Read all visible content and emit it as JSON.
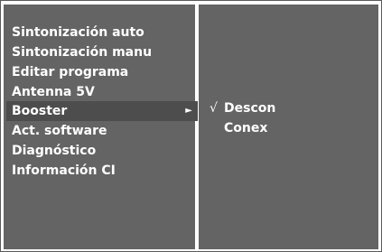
{
  "menu": {
    "items": [
      {
        "label": "Sintonización auto"
      },
      {
        "label": "Sintonización manu"
      },
      {
        "label": "Editar programa"
      },
      {
        "label": "Antenna 5V"
      },
      {
        "label": "Booster",
        "selected": true,
        "arrow": "►"
      },
      {
        "label": "Act. software"
      },
      {
        "label": "Diagnóstico"
      },
      {
        "label": "Información CI"
      }
    ]
  },
  "submenu": {
    "options": [
      {
        "check": "√",
        "label": "Descon"
      },
      {
        "check": "",
        "label": "Conex"
      }
    ]
  }
}
